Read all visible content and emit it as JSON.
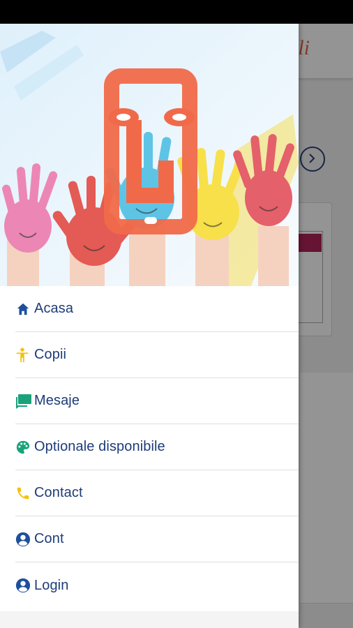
{
  "background": {
    "appbar_title": "li",
    "accent_color": "#b0245a"
  },
  "drawer": {
    "menu": [
      {
        "id": "acasa",
        "label": "Acasa",
        "icon": "home-icon",
        "color": "#1e4f9b"
      },
      {
        "id": "copii",
        "label": "Copii",
        "icon": "child-icon",
        "color": "#f4c20d"
      },
      {
        "id": "mesaje",
        "label": "Mesaje",
        "icon": "chat-icon",
        "color": "#1aa37a"
      },
      {
        "id": "optionale",
        "label": "Optionale disponibile",
        "icon": "palette-icon",
        "color": "#1aa37a"
      },
      {
        "id": "contact",
        "label": "Contact",
        "icon": "phone-icon",
        "color": "#f4c20d"
      },
      {
        "id": "cont",
        "label": "Cont",
        "icon": "account-icon",
        "color": "#1e4f9b"
      },
      {
        "id": "login",
        "label": "Login",
        "icon": "account-icon",
        "color": "#1e4f9b"
      }
    ]
  }
}
